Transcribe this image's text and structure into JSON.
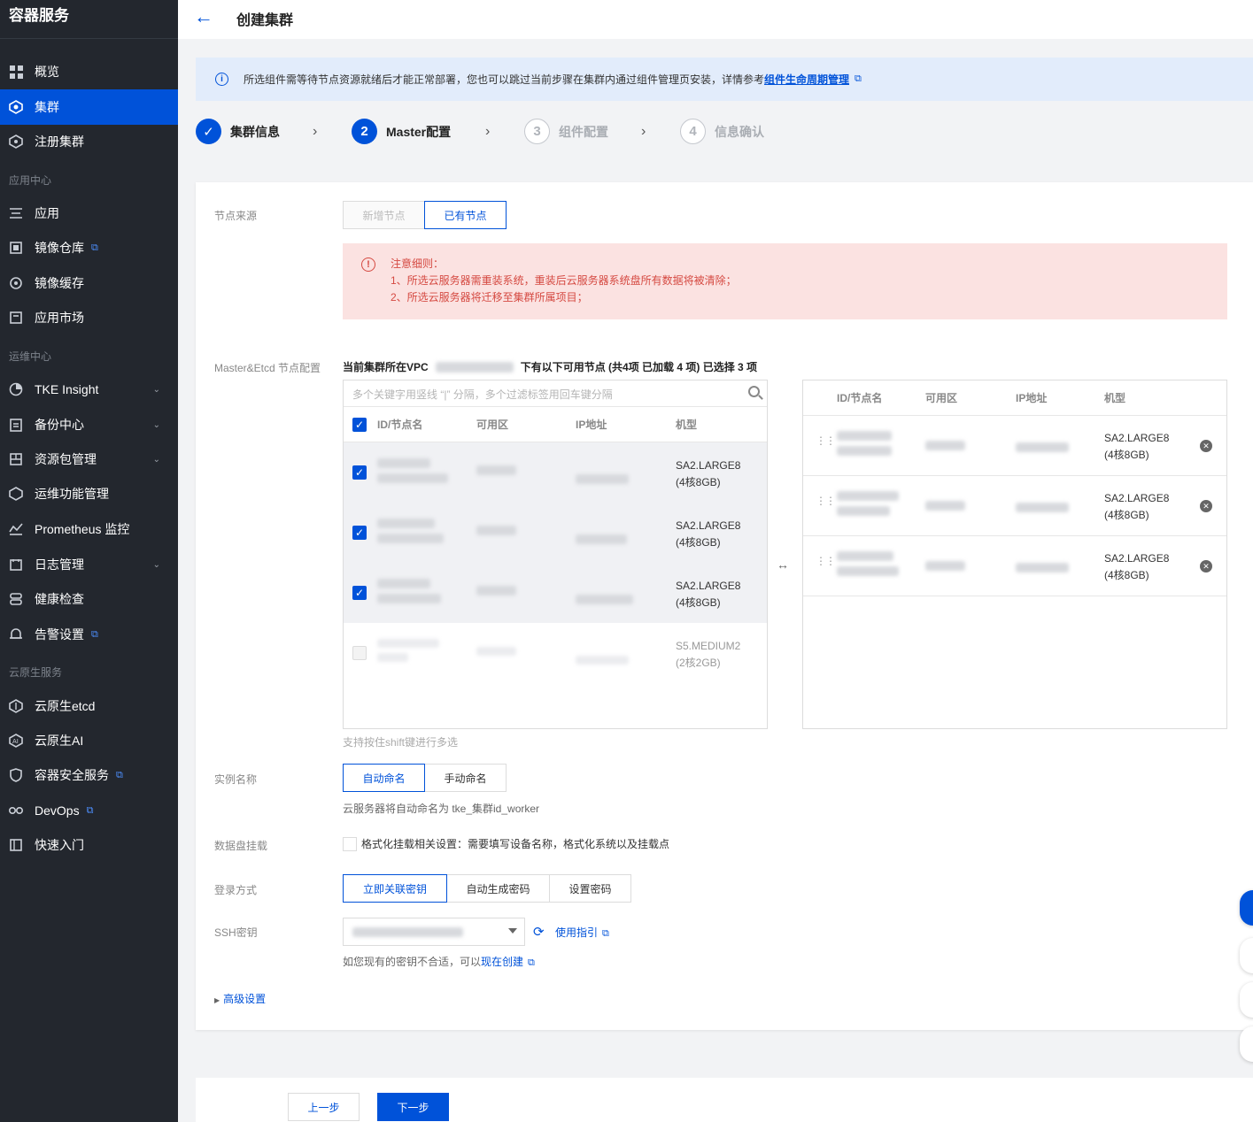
{
  "sidebar": {
    "brand": "容器服务",
    "items": [
      {
        "label": "概览",
        "icon": "grid-icon"
      },
      {
        "label": "集群",
        "icon": "cluster-icon"
      },
      {
        "label": "注册集群",
        "icon": "register-icon"
      },
      {
        "label": "应用",
        "icon": "app-icon"
      },
      {
        "label": "镜像仓库",
        "icon": "image-repo-icon"
      },
      {
        "label": "镜像缓存",
        "icon": "image-cache-icon"
      },
      {
        "label": "应用市场",
        "icon": "market-icon"
      },
      {
        "label": "TKE Insight",
        "icon": "insight-icon"
      },
      {
        "label": "备份中心",
        "icon": "backup-icon"
      },
      {
        "label": "资源包管理",
        "icon": "package-icon"
      },
      {
        "label": "运维功能管理",
        "icon": "ops-icon"
      },
      {
        "label": "Prometheus 监控",
        "icon": "monitor-icon"
      },
      {
        "label": "日志管理",
        "icon": "log-icon"
      },
      {
        "label": "健康检查",
        "icon": "health-icon"
      },
      {
        "label": "告警设置",
        "icon": "alarm-icon"
      },
      {
        "label": "云原生etcd",
        "icon": "etcd-icon"
      },
      {
        "label": "云原生AI",
        "icon": "ai-icon"
      },
      {
        "label": "容器安全服务",
        "icon": "shield-icon"
      },
      {
        "label": "DevOps",
        "icon": "devops-icon"
      },
      {
        "label": "快速入门",
        "icon": "book-icon"
      }
    ],
    "groups": [
      "应用中心",
      "运维中心",
      "云原生服务"
    ]
  },
  "header": {
    "title": "创建集群"
  },
  "banner": {
    "text": "所选组件需等待节点资源就绪后才能正常部署，您也可以跳过当前步骤在集群内通过组件管理页安装，详情参考",
    "link": "组件生命周期管理"
  },
  "steps": [
    {
      "num": "✓",
      "label": "集群信息",
      "state": "done"
    },
    {
      "num": "2",
      "label": "Master配置",
      "state": "active"
    },
    {
      "num": "3",
      "label": "组件配置",
      "state": "todo"
    },
    {
      "num": "4",
      "label": "信息确认",
      "state": "todo"
    }
  ],
  "form": {
    "node_source": {
      "label": "节点来源",
      "options": [
        "新增节点",
        "已有节点"
      ],
      "selected": "已有节点"
    },
    "warning": {
      "title": "注意细则：",
      "lines": [
        "1、所选云服务器需重装系统，重装后云服务器系统盘所有数据将被清除；",
        "2、所选云服务器将迁移至集群所属项目；"
      ]
    },
    "master_etcd": {
      "label": "Master&Etcd 节点配置",
      "vpc_prefix": "当前集群所在VPC",
      "vpc_suffix": "下有以下可用节点 (共4项 已加载 4 项) 已选择 3 项",
      "search_placeholder": "多个关键字用竖线 “|” 分隔，多个过滤标签用回车键分隔",
      "columns": [
        "ID/节点名",
        "可用区",
        "IP地址",
        "机型"
      ],
      "left_rows": [
        {
          "type": "SA2.LARGE8",
          "spec": "(4核8GB)",
          "checked": true
        },
        {
          "type": "SA2.LARGE8",
          "spec": "(4核8GB)",
          "checked": true
        },
        {
          "type": "SA2.LARGE8",
          "spec": "(4核8GB)",
          "checked": true
        },
        {
          "type": "S5.MEDIUM2",
          "spec": "(2核2GB)",
          "checked": false
        }
      ],
      "right_rows": [
        {
          "type": "SA2.LARGE8",
          "spec": "(4核8GB)"
        },
        {
          "type": "SA2.LARGE8",
          "spec": "(4核8GB)"
        },
        {
          "type": "SA2.LARGE8",
          "spec": "(4核8GB)"
        }
      ],
      "hint": "支持按住shift键进行多选"
    },
    "instance_name": {
      "label": "实例名称",
      "options": [
        "自动命名",
        "手动命名"
      ],
      "selected": "自动命名",
      "hint": "云服务器将自动命名为 tke_集群id_worker"
    },
    "data_disk": {
      "label": "数据盘挂载",
      "checkbox": "格式化挂载相关设置：需要填写设备名称，格式化系统以及挂载点"
    },
    "login": {
      "label": "登录方式",
      "options": [
        "立即关联密钥",
        "自动生成密码",
        "设置密码"
      ],
      "selected": "立即关联密钥"
    },
    "ssh": {
      "label": "SSH密钥",
      "guide": "使用指引",
      "hint_prefix": "如您现有的密钥不合适，可以",
      "hint_link": "现在创建"
    },
    "advanced": "高级设置"
  },
  "footer": {
    "prev": "上一步",
    "next": "下一步"
  },
  "colors": {
    "primary": "#0052d9",
    "sidebar": "#23272e",
    "warning_bg": "#fbe2e1",
    "warning_text": "#d54941"
  }
}
